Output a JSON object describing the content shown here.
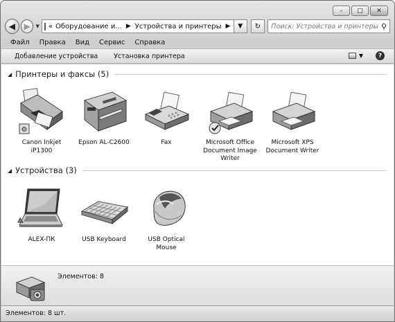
{
  "window": {
    "caption_buttons": {
      "minimize": "–",
      "maximize": "□",
      "close": "✕"
    }
  },
  "nav": {
    "back_glyph": "◀",
    "forward_glyph": "▶",
    "recent_glyph": "▼",
    "address": {
      "overflow": "«",
      "segments": [
        "Оборудование и...",
        "Устройства и принтеры"
      ],
      "chevron": "▶",
      "dropdown_glyph": "▼"
    },
    "refresh_glyph": "↻",
    "search": {
      "placeholder": "Поиск: Устройства и принтеры",
      "icon": "search-icon"
    }
  },
  "menu": [
    "Файл",
    "Правка",
    "Вид",
    "Сервис",
    "Справка"
  ],
  "toolbar": {
    "add_device": "Добавление устройства",
    "add_printer": "Установка принтера",
    "view_dropdown": "▼",
    "help": "?"
  },
  "groups": [
    {
      "title": "Принтеры и факсы (5)",
      "items": [
        {
          "label1": "Canon Inkjet",
          "label2": "iP1300",
          "label3": "",
          "icon": "inkjet-printer-icon"
        },
        {
          "label1": "Epson AL-C2600",
          "label2": "",
          "label3": "",
          "icon": "laser-printer-icon"
        },
        {
          "label1": "Fax",
          "label2": "",
          "label3": "",
          "icon": "fax-icon"
        },
        {
          "label1": "Microsoft Office",
          "label2": "Document Image",
          "label3": "Writer",
          "icon": "default-printer-icon"
        },
        {
          "label1": "Microsoft XPS",
          "label2": "Document Writer",
          "label3": "",
          "icon": "printer-icon"
        }
      ]
    },
    {
      "title": "Устройства (3)",
      "items": [
        {
          "label1": "ALEX-ПК",
          "label2": "",
          "label3": "",
          "icon": "laptop-icon"
        },
        {
          "label1": "USB Keyboard",
          "label2": "",
          "label3": "",
          "icon": "keyboard-icon"
        },
        {
          "label1": "USB Optical",
          "label2": "Mouse",
          "label3": "",
          "icon": "mouse-icon"
        }
      ]
    }
  ],
  "details": {
    "count": "Элементов: 8"
  },
  "status": {
    "text": "Элементов: 8 шт."
  }
}
